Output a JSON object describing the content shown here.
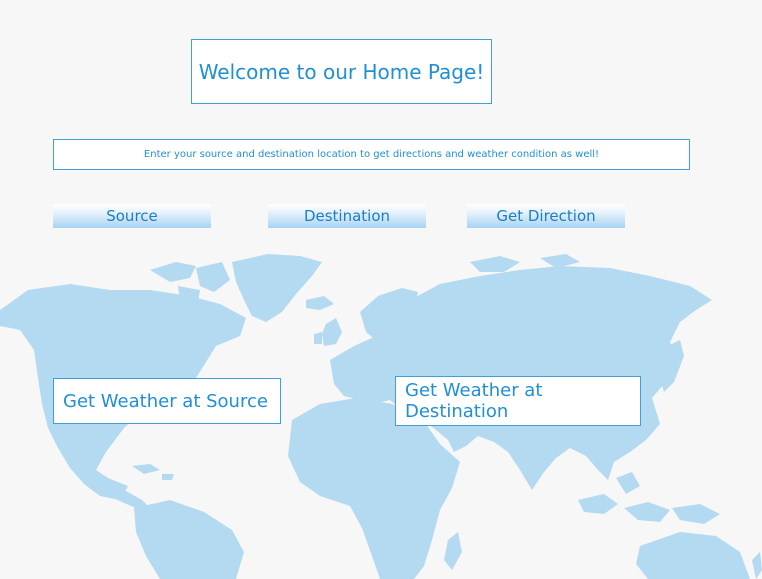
{
  "header": {
    "title": "Welcome to our Home Page!"
  },
  "intro": {
    "text": "Enter your source and destination location to get directions and weather condition as well!"
  },
  "buttons": {
    "source": "Source",
    "destination": "Destination",
    "get_direction": "Get Direction"
  },
  "weather": {
    "source": "Get Weather at Source",
    "destination": "Get Weather at Destination"
  },
  "colors": {
    "accent": "#1f8fd6",
    "map_fill": "#b3daf0",
    "background": "#f7f7f7"
  }
}
